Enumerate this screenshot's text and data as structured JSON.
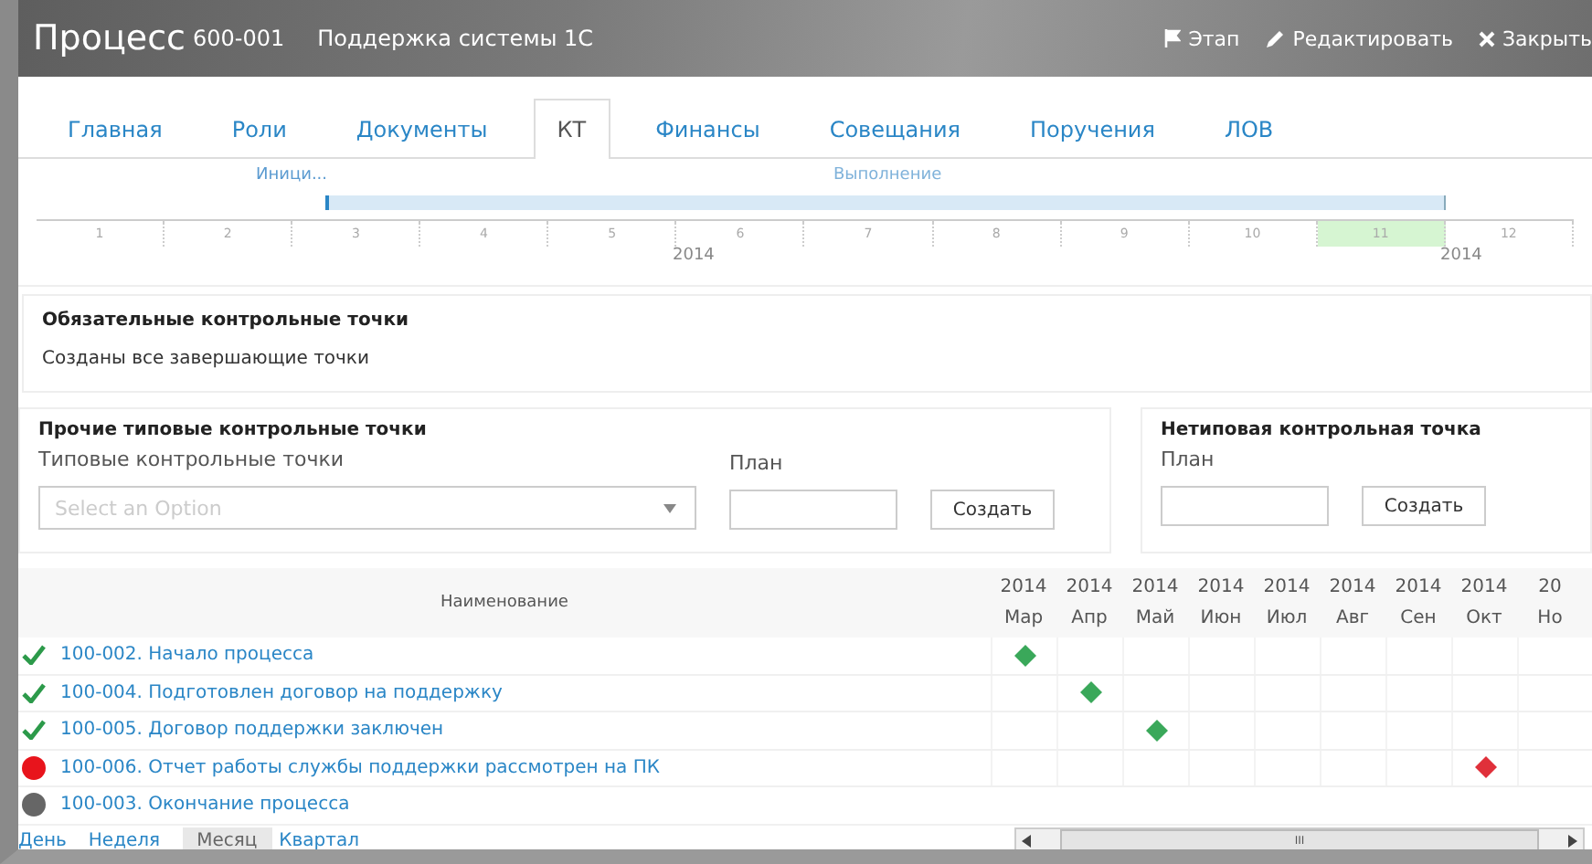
{
  "header": {
    "title": "Процесс",
    "number": "600-001",
    "name": "Поддержка системы 1С",
    "actions": [
      {
        "kind": "flag",
        "label": "Этап"
      },
      {
        "kind": "edit",
        "label": "Редактировать"
      },
      {
        "kind": "close",
        "label": "Закрыть"
      }
    ]
  },
  "tabs": [
    {
      "label": "Главная",
      "selected": false
    },
    {
      "label": "Роли",
      "selected": false
    },
    {
      "label": "Документы",
      "selected": false
    },
    {
      "label": "КТ",
      "selected": true
    },
    {
      "label": "Финансы",
      "selected": false
    },
    {
      "label": "Совещания",
      "selected": false
    },
    {
      "label": "Поручения",
      "selected": false
    },
    {
      "label": "ЛОВ",
      "selected": false
    }
  ],
  "timeline": {
    "phases": [
      {
        "label": "Иници..."
      },
      {
        "label": "Выполнение"
      }
    ],
    "months": [
      {
        "label": "1",
        "selected": false
      },
      {
        "label": "2",
        "selected": false
      },
      {
        "label": "3",
        "selected": false
      },
      {
        "label": "4",
        "selected": false
      },
      {
        "label": "5",
        "selected": false
      },
      {
        "label": "6",
        "selected": false
      },
      {
        "label": "7",
        "selected": false
      },
      {
        "label": "8",
        "selected": false
      },
      {
        "label": "9",
        "selected": false
      },
      {
        "label": "10",
        "selected": false
      },
      {
        "label": "11",
        "selected": true
      },
      {
        "label": "12",
        "selected": false
      }
    ],
    "years": [
      "2014",
      "2014"
    ]
  },
  "mandatory": {
    "title": "Обязательные контрольные точки",
    "text": "Созданы все завершающие точки"
  },
  "typical": {
    "title": "Прочие типовые контрольные точки",
    "select_label": "Типовые контрольные точки",
    "select": {
      "placeholder": "Select an Option"
    },
    "plan_label": "План",
    "button": "Создать"
  },
  "custom": {
    "title": "Нетиповая контрольная точка",
    "plan_label": "План",
    "button": "Создать"
  },
  "gantt": {
    "name_header": "Наименование",
    "columns": [
      {
        "year": "2014",
        "month": "Мар"
      },
      {
        "year": "2014",
        "month": "Апр"
      },
      {
        "year": "2014",
        "month": "Май"
      },
      {
        "year": "2014",
        "month": "Июн"
      },
      {
        "year": "2014",
        "month": "Июл"
      },
      {
        "year": "2014",
        "month": "Авг"
      },
      {
        "year": "2014",
        "month": "Сен"
      },
      {
        "year": "2014",
        "month": "Окт"
      },
      {
        "year": "20",
        "month": "Но"
      }
    ],
    "rows": [
      {
        "kind": "done",
        "name": "100-002. Начало процесса",
        "color": "#3aa85a",
        "cells": [
          {
            "milestone": true
          },
          {
            "milestone": false
          },
          {
            "milestone": false
          },
          {
            "milestone": false
          },
          {
            "milestone": false
          },
          {
            "milestone": false
          },
          {
            "milestone": false
          },
          {
            "milestone": false
          },
          {
            "milestone": false
          }
        ]
      },
      {
        "kind": "done",
        "name": "100-004. Подготовлен договор на поддержку",
        "color": "#3aa85a",
        "cells": [
          {
            "milestone": false
          },
          {
            "milestone": true
          },
          {
            "milestone": false
          },
          {
            "milestone": false
          },
          {
            "milestone": false
          },
          {
            "milestone": false
          },
          {
            "milestone": false
          },
          {
            "milestone": false
          },
          {
            "milestone": false
          }
        ]
      },
      {
        "kind": "done",
        "name": "100-005. Договор поддержки заключен",
        "color": "#3aa85a",
        "cells": [
          {
            "milestone": false
          },
          {
            "milestone": false
          },
          {
            "milestone": true
          },
          {
            "milestone": false
          },
          {
            "milestone": false
          },
          {
            "milestone": false
          },
          {
            "milestone": false
          },
          {
            "milestone": false
          },
          {
            "milestone": false
          }
        ]
      },
      {
        "kind": "overdue",
        "name": "100-006. Отчет работы службы поддержки рассмотрен на ПК",
        "color": "#e0303a",
        "cells": [
          {
            "milestone": false
          },
          {
            "milestone": false
          },
          {
            "milestone": false
          },
          {
            "milestone": false
          },
          {
            "milestone": false
          },
          {
            "milestone": false
          },
          {
            "milestone": false
          },
          {
            "milestone": true
          },
          {
            "milestone": false
          }
        ]
      },
      {
        "kind": "pending",
        "name": "100-003. Окончание процесса"
      }
    ],
    "views": [
      {
        "label": "День",
        "selected": false
      },
      {
        "label": "Неделя",
        "selected": false
      },
      {
        "label": "Месяц",
        "selected": true
      },
      {
        "label": "Квартал",
        "selected": false
      }
    ],
    "scroll_grip": "III"
  }
}
